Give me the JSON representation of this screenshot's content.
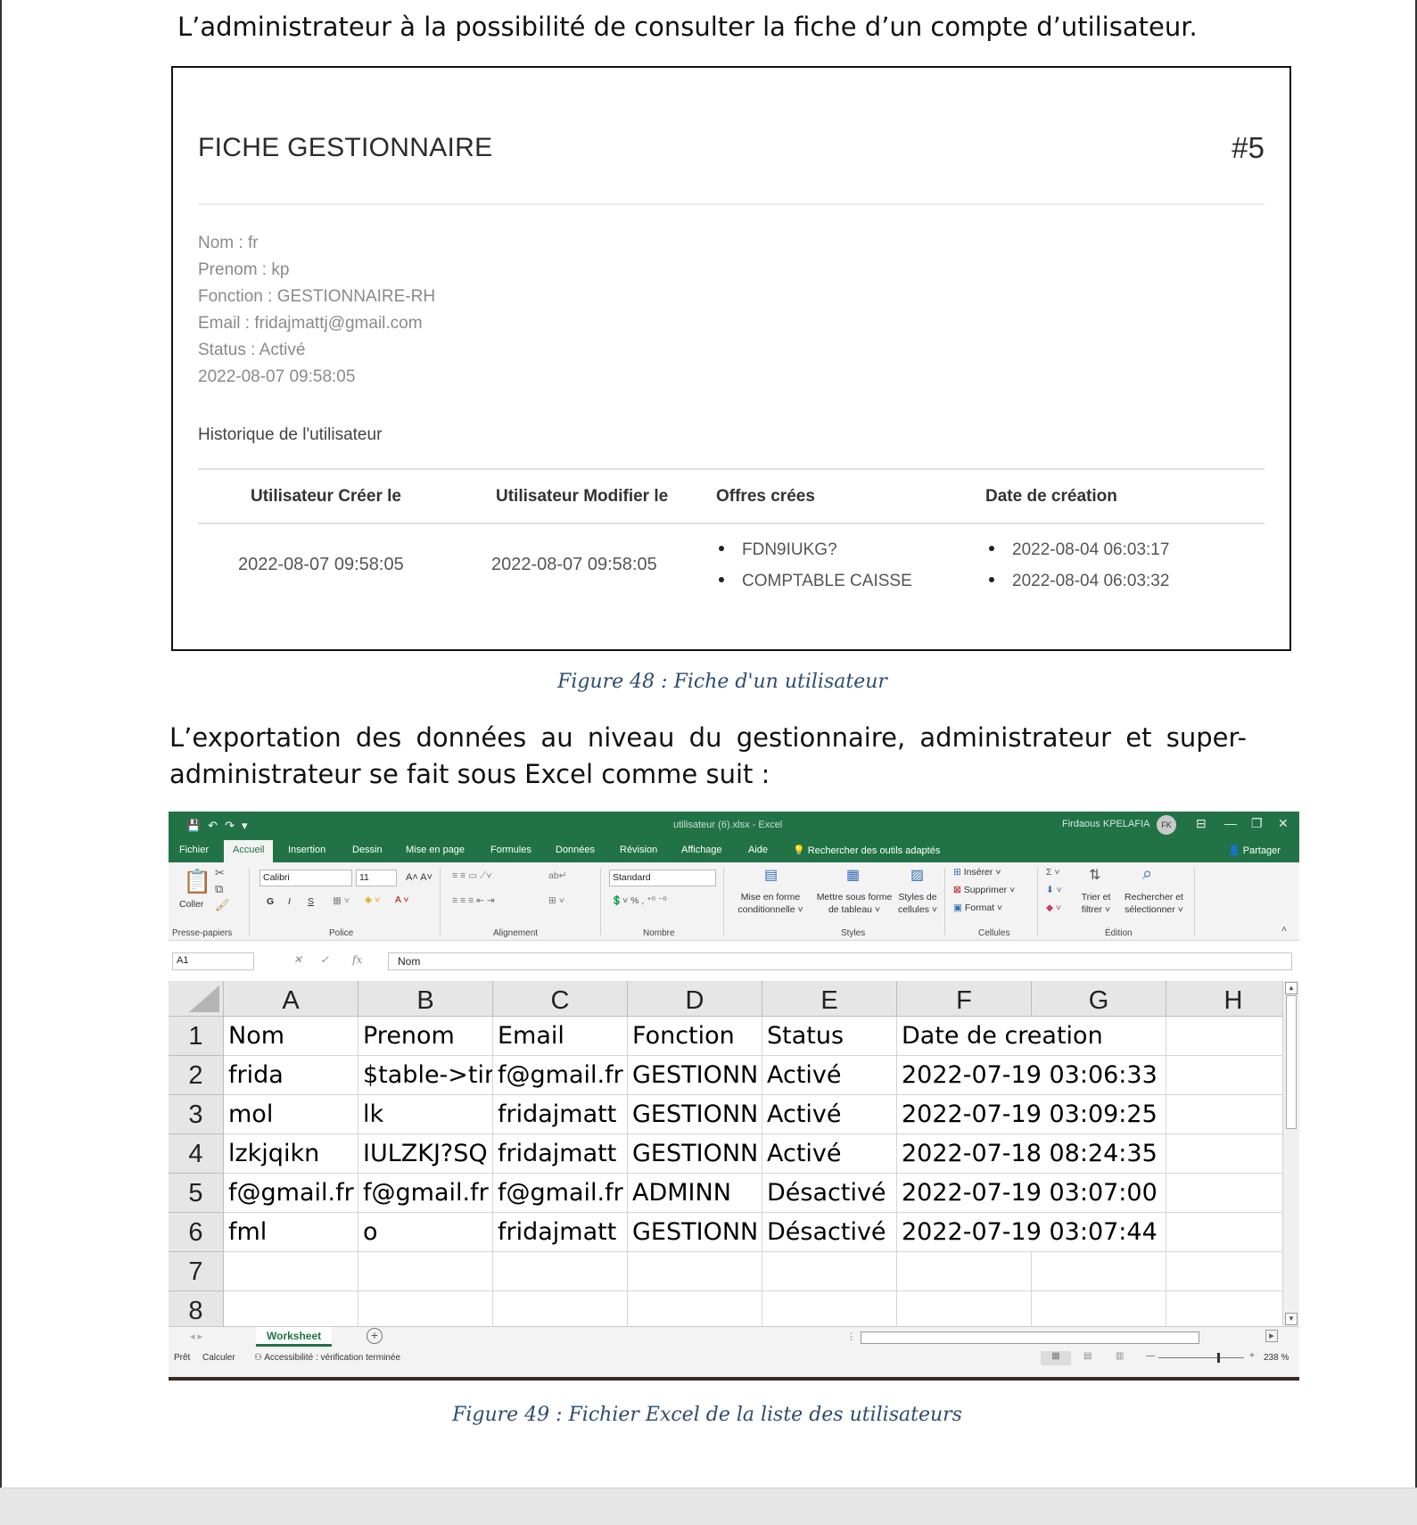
{
  "doc": {
    "para1": "L’administrateur à la possibilité de consulter la fiche d’un compte d’utilisateur.",
    "para2": "L’exportation des données au niveau du gestionnaire, administrateur et super-administrateur se fait sous Excel comme suit :",
    "caption1": "Figure 48 : Fiche d'un utilisateur",
    "caption2": "Figure 49 : Fichier Excel de la liste des utilisateurs"
  },
  "fiche": {
    "title": "FICHE GESTIONNAIRE",
    "id": "#5",
    "info": [
      "Nom : fr",
      "Prenom : kp",
      "Fonction : GESTIONNAIRE-RH",
      "Email : fridajmattj@gmail.com",
      "Status : Activé",
      "2022-08-07 09:58:05"
    ],
    "history_title": "Historique de l'utilisateur",
    "headers": [
      "Utilisateur Créer le",
      "Utilisateur Modifier le",
      "Offres crées",
      "Date de création"
    ],
    "created": "2022-08-07 09:58:05",
    "modified": "2022-08-07 09:58:05",
    "offers": [
      "FDN9IUKG?",
      "COMPTABLE CAISSE"
    ],
    "offer_dates": [
      "2022-08-04 06:03:17",
      "2022-08-04 06:03:32"
    ]
  },
  "excel": {
    "accent": "#217346",
    "file_title": "utilisateur (6).xlsx  -  Excel",
    "user_name": "Firdaous KPELAFIA",
    "user_initials": "FK",
    "tabs": [
      "Fichier",
      "Accueil",
      "Insertion",
      "Dessin",
      "Mise en page",
      "Formules",
      "Données",
      "Révision",
      "Affichage",
      "Aide"
    ],
    "search_label": "Rechercher des outils adaptés",
    "share_label": "Partager",
    "ribbon": {
      "paste": "Coller",
      "clipboard": "Presse-papiers",
      "font_name": "Calibri",
      "font_size": "11",
      "bold": "G",
      "italic": "I",
      "underline": "S",
      "font_group": "Police",
      "alignment_group": "Alignement",
      "number_format": "Standard",
      "number_group": "Nombre",
      "cond_format": "Mise en forme conditionnelle ˅",
      "format_table": "Mettre sous forme de tableau ˅",
      "cell_styles": "Styles de cellules ˅",
      "styles_group": "Styles",
      "insert": "Insérer",
      "delete": "Supprimer",
      "format": "Format",
      "cells_group": "Cellules",
      "sort_filter": "Trier et filtrer ˅",
      "find_select": "Rechercher et sélectionner ˅",
      "edit_group": "Édition"
    },
    "name_box": "A1",
    "formula": "Nom",
    "columns": [
      "A",
      "B",
      "C",
      "D",
      "E",
      "F",
      "G",
      "H"
    ],
    "rows": [
      [
        "Nom",
        "Prenom",
        "Email",
        "Fonction",
        "Status",
        "Date de creation"
      ],
      [
        "frida",
        "$table->tir",
        "f@gmail.fr",
        "GESTIONN",
        "Activé",
        "2022-07-19 03:06:33"
      ],
      [
        "mol",
        "lk",
        "fridajmatt",
        "GESTIONN",
        "Activé",
        "2022-07-19 03:09:25"
      ],
      [
        "lzkjqikn",
        "IULZKJ?SQ",
        "fridajmatt",
        "GESTIONN",
        "Activé",
        "2022-07-18 08:24:35"
      ],
      [
        "f@gmail.fr",
        "f@gmail.fr",
        "f@gmail.fr",
        "ADMINN",
        "Désactivé",
        "2022-07-19 03:07:00"
      ],
      [
        "fml",
        "o",
        "fridajmatt",
        "GESTIONN",
        "Désactivé",
        "2022-07-19 03:07:44"
      ],
      [
        "",
        "",
        "",
        "",
        "",
        ""
      ],
      [
        "",
        "",
        "",
        "",
        "",
        ""
      ]
    ],
    "row_numbers": [
      "1",
      "2",
      "3",
      "4",
      "5",
      "6",
      "7",
      "8"
    ],
    "sheet_tab": "Worksheet",
    "status": {
      "ready": "Prêt",
      "calc": "Calculer",
      "accessibility": "Accessibilité : vérification terminée",
      "zoom": "238 %"
    }
  }
}
